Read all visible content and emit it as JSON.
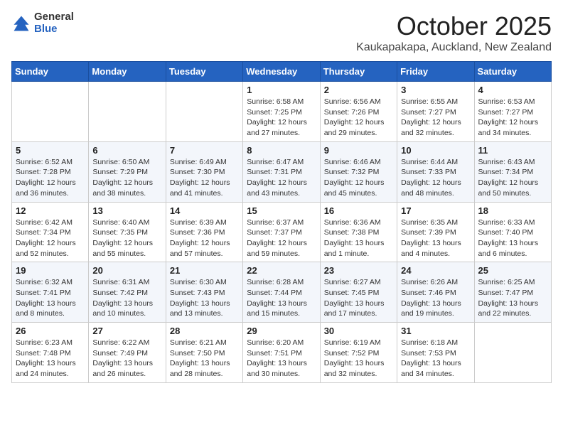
{
  "logo": {
    "general": "General",
    "blue": "Blue"
  },
  "title": {
    "month": "October 2025",
    "location": "Kaukapakapa, Auckland, New Zealand"
  },
  "headers": [
    "Sunday",
    "Monday",
    "Tuesday",
    "Wednesday",
    "Thursday",
    "Friday",
    "Saturday"
  ],
  "weeks": [
    [
      {
        "day": "",
        "info": ""
      },
      {
        "day": "",
        "info": ""
      },
      {
        "day": "",
        "info": ""
      },
      {
        "day": "1",
        "info": "Sunrise: 6:58 AM\nSunset: 7:25 PM\nDaylight: 12 hours and 27 minutes."
      },
      {
        "day": "2",
        "info": "Sunrise: 6:56 AM\nSunset: 7:26 PM\nDaylight: 12 hours and 29 minutes."
      },
      {
        "day": "3",
        "info": "Sunrise: 6:55 AM\nSunset: 7:27 PM\nDaylight: 12 hours and 32 minutes."
      },
      {
        "day": "4",
        "info": "Sunrise: 6:53 AM\nSunset: 7:27 PM\nDaylight: 12 hours and 34 minutes."
      }
    ],
    [
      {
        "day": "5",
        "info": "Sunrise: 6:52 AM\nSunset: 7:28 PM\nDaylight: 12 hours and 36 minutes."
      },
      {
        "day": "6",
        "info": "Sunrise: 6:50 AM\nSunset: 7:29 PM\nDaylight: 12 hours and 38 minutes."
      },
      {
        "day": "7",
        "info": "Sunrise: 6:49 AM\nSunset: 7:30 PM\nDaylight: 12 hours and 41 minutes."
      },
      {
        "day": "8",
        "info": "Sunrise: 6:47 AM\nSunset: 7:31 PM\nDaylight: 12 hours and 43 minutes."
      },
      {
        "day": "9",
        "info": "Sunrise: 6:46 AM\nSunset: 7:32 PM\nDaylight: 12 hours and 45 minutes."
      },
      {
        "day": "10",
        "info": "Sunrise: 6:44 AM\nSunset: 7:33 PM\nDaylight: 12 hours and 48 minutes."
      },
      {
        "day": "11",
        "info": "Sunrise: 6:43 AM\nSunset: 7:34 PM\nDaylight: 12 hours and 50 minutes."
      }
    ],
    [
      {
        "day": "12",
        "info": "Sunrise: 6:42 AM\nSunset: 7:34 PM\nDaylight: 12 hours and 52 minutes."
      },
      {
        "day": "13",
        "info": "Sunrise: 6:40 AM\nSunset: 7:35 PM\nDaylight: 12 hours and 55 minutes."
      },
      {
        "day": "14",
        "info": "Sunrise: 6:39 AM\nSunset: 7:36 PM\nDaylight: 12 hours and 57 minutes."
      },
      {
        "day": "15",
        "info": "Sunrise: 6:37 AM\nSunset: 7:37 PM\nDaylight: 12 hours and 59 minutes."
      },
      {
        "day": "16",
        "info": "Sunrise: 6:36 AM\nSunset: 7:38 PM\nDaylight: 13 hours and 1 minute."
      },
      {
        "day": "17",
        "info": "Sunrise: 6:35 AM\nSunset: 7:39 PM\nDaylight: 13 hours and 4 minutes."
      },
      {
        "day": "18",
        "info": "Sunrise: 6:33 AM\nSunset: 7:40 PM\nDaylight: 13 hours and 6 minutes."
      }
    ],
    [
      {
        "day": "19",
        "info": "Sunrise: 6:32 AM\nSunset: 7:41 PM\nDaylight: 13 hours and 8 minutes."
      },
      {
        "day": "20",
        "info": "Sunrise: 6:31 AM\nSunset: 7:42 PM\nDaylight: 13 hours and 10 minutes."
      },
      {
        "day": "21",
        "info": "Sunrise: 6:30 AM\nSunset: 7:43 PM\nDaylight: 13 hours and 13 minutes."
      },
      {
        "day": "22",
        "info": "Sunrise: 6:28 AM\nSunset: 7:44 PM\nDaylight: 13 hours and 15 minutes."
      },
      {
        "day": "23",
        "info": "Sunrise: 6:27 AM\nSunset: 7:45 PM\nDaylight: 13 hours and 17 minutes."
      },
      {
        "day": "24",
        "info": "Sunrise: 6:26 AM\nSunset: 7:46 PM\nDaylight: 13 hours and 19 minutes."
      },
      {
        "day": "25",
        "info": "Sunrise: 6:25 AM\nSunset: 7:47 PM\nDaylight: 13 hours and 22 minutes."
      }
    ],
    [
      {
        "day": "26",
        "info": "Sunrise: 6:23 AM\nSunset: 7:48 PM\nDaylight: 13 hours and 24 minutes."
      },
      {
        "day": "27",
        "info": "Sunrise: 6:22 AM\nSunset: 7:49 PM\nDaylight: 13 hours and 26 minutes."
      },
      {
        "day": "28",
        "info": "Sunrise: 6:21 AM\nSunset: 7:50 PM\nDaylight: 13 hours and 28 minutes."
      },
      {
        "day": "29",
        "info": "Sunrise: 6:20 AM\nSunset: 7:51 PM\nDaylight: 13 hours and 30 minutes."
      },
      {
        "day": "30",
        "info": "Sunrise: 6:19 AM\nSunset: 7:52 PM\nDaylight: 13 hours and 32 minutes."
      },
      {
        "day": "31",
        "info": "Sunrise: 6:18 AM\nSunset: 7:53 PM\nDaylight: 13 hours and 34 minutes."
      },
      {
        "day": "",
        "info": ""
      }
    ]
  ]
}
